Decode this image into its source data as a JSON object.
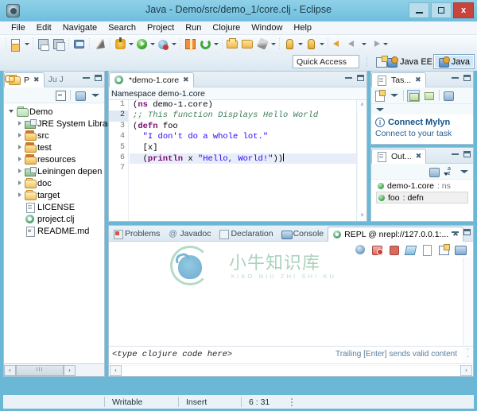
{
  "window": {
    "title": "Java - Demo/src/demo_1/core.clj - Eclipse",
    "app_icon": "eclipse-icon",
    "minimize": "–",
    "maximize": "□",
    "close": "x"
  },
  "menubar": {
    "items": [
      "File",
      "Edit",
      "Navigate",
      "Search",
      "Project",
      "Run",
      "Clojure",
      "Window",
      "Help"
    ]
  },
  "toolbar": {
    "icons": [
      "new-wizard-icon",
      "save-icon",
      "save-all-icon",
      "print-icon",
      "toggle-mark-occurrences-icon",
      "debug-icon",
      "run-icon",
      "profile-icon",
      "new-package-icon",
      "refresh-icon",
      "open-type-icon",
      "open-resource-icon",
      "build-icon",
      "next-annotation-icon",
      "previous-annotation-icon",
      "back-icon",
      "forward-icon"
    ],
    "quick_access": {
      "placeholder": "Quick Access",
      "value": "Quick Access"
    },
    "open_perspective_icon": "open-perspective-icon",
    "perspectives": [
      {
        "label": "Java EE",
        "active": false
      },
      {
        "label": "Java",
        "active": true
      }
    ]
  },
  "package_explorer": {
    "tabs": [
      {
        "label": "P",
        "active": true,
        "icon": "package-explorer-icon",
        "closable": true
      },
      {
        "label": "Ju J",
        "active": false,
        "icon": "junit-icon",
        "closable": false
      }
    ],
    "view_buttons": [
      "minimize-icon",
      "maximize-icon"
    ],
    "tools": [
      "collapse-all-icon",
      "link-with-editor-icon",
      "view-menu-icon",
      "view-dropdown-icon"
    ],
    "tree": [
      {
        "label": "Demo",
        "icon": "project-icon",
        "indent": 0,
        "arrow": "open"
      },
      {
        "label": "JRE System Librar",
        "icon": "library-icon",
        "indent": 1,
        "arrow": "closed"
      },
      {
        "label": "src",
        "icon": "source-folder-icon",
        "indent": 1,
        "arrow": "closed"
      },
      {
        "label": "test",
        "icon": "source-folder-icon",
        "indent": 1,
        "arrow": "closed"
      },
      {
        "label": "resources",
        "icon": "source-folder-icon",
        "indent": 1,
        "arrow": "closed"
      },
      {
        "label": "Leiningen depen",
        "icon": "library-icon",
        "indent": 1,
        "arrow": "closed"
      },
      {
        "label": "doc",
        "icon": "folder-icon",
        "indent": 1,
        "arrow": "closed"
      },
      {
        "label": "target",
        "icon": "folder-icon",
        "indent": 1,
        "arrow": "closed"
      },
      {
        "label": "LICENSE",
        "icon": "file-icon",
        "indent": 1,
        "arrow": "none"
      },
      {
        "label": "project.clj",
        "icon": "clojure-file-icon",
        "indent": 1,
        "arrow": "none"
      },
      {
        "label": "README.md",
        "icon": "markdown-file-icon",
        "indent": 1,
        "arrow": "none"
      }
    ],
    "hscroll": {
      "left_arrow": "‹",
      "right_arrow": "›",
      "thumb": "III"
    }
  },
  "editor": {
    "tab": {
      "label": "*demo-1.core",
      "icon": "clojure-file-icon",
      "close": "✖"
    },
    "breadcrumb": "Namespace demo-1.core",
    "view_buttons": [
      "minimize-icon",
      "maximize-icon"
    ],
    "lines": [
      {
        "num": "1",
        "selected": false,
        "highlight": false,
        "tokens": [
          {
            "t": "(",
            "c": "pn"
          },
          {
            "t": "ns",
            "c": "kw"
          },
          {
            "t": " demo-1.core)",
            "c": "pn"
          }
        ]
      },
      {
        "num": "2",
        "selected": true,
        "highlight": false,
        "tokens": [
          {
            "t": ";; This function Displays Hello World",
            "c": "cm"
          }
        ]
      },
      {
        "num": "3",
        "selected": false,
        "highlight": false,
        "tokens": [
          {
            "t": "(",
            "c": "pn"
          },
          {
            "t": "defn",
            "c": "kw"
          },
          {
            "t": " foo",
            "c": "pn"
          }
        ]
      },
      {
        "num": "4",
        "selected": false,
        "highlight": false,
        "tokens": [
          {
            "t": "  ",
            "c": "pn"
          },
          {
            "t": "\"I don't do a whole lot.\"",
            "c": "st"
          }
        ]
      },
      {
        "num": "5",
        "selected": false,
        "highlight": false,
        "tokens": [
          {
            "t": "  [x]",
            "c": "pn"
          }
        ]
      },
      {
        "num": "6",
        "selected": false,
        "highlight": true,
        "tokens": [
          {
            "t": "  (",
            "c": "pn"
          },
          {
            "t": "println",
            "c": "kw"
          },
          {
            "t": " x ",
            "c": "pn"
          },
          {
            "t": "\"Hello, World!\"",
            "c": "st"
          },
          {
            "t": "))",
            "c": "pn"
          }
        ]
      },
      {
        "num": "7",
        "selected": false,
        "highlight": false,
        "tokens": [
          {
            "t": "",
            "c": "pn"
          }
        ]
      }
    ],
    "scrollbar": {
      "up": "˄",
      "down": "˅"
    }
  },
  "task_list": {
    "tab": {
      "label": "Tas...",
      "icon": "task-list-icon",
      "close": "✖"
    },
    "view_buttons": [
      "minimize-icon",
      "maximize-icon"
    ],
    "tools": [
      "new-task-icon",
      "categorized-presentation-icon",
      "scheduled-presentation-icon",
      "focus-on-workweek-icon",
      "view-menu-icon"
    ],
    "mylyn": {
      "title": "Connect Mylyn",
      "subtitle": "Connect to your task"
    }
  },
  "outline": {
    "tab": {
      "label": "Out...",
      "icon": "outline-icon",
      "close": "✖"
    },
    "view_buttons": [
      "minimize-icon",
      "maximize-icon"
    ],
    "tools": [
      "view-menu-icon",
      "sort-icon",
      "view-dropdown-icon"
    ],
    "items": [
      {
        "name": "demo-1.core",
        "kind": "ns",
        "selected": false
      },
      {
        "name": "foo",
        "kind": "defn",
        "selected": true
      }
    ]
  },
  "bottom_panel": {
    "tabs": [
      {
        "label": "Problems",
        "icon": "problems-icon",
        "active": false
      },
      {
        "label": "Javadoc",
        "icon": "javadoc-icon",
        "active": false
      },
      {
        "label": "Declaration",
        "icon": "declaration-icon",
        "active": false
      },
      {
        "label": "Console",
        "icon": "console-icon",
        "active": false
      },
      {
        "label": "REPL @ nrepl://127.0.0.1:...",
        "icon": "repl-icon",
        "active": true,
        "close": "✖"
      }
    ],
    "view_buttons": [
      "minimize-icon",
      "maximize-icon"
    ],
    "tools": [
      "reconnect-icon",
      "interrupt-evaluation-icon",
      "terminate-icon",
      "clear-icon",
      "clear-output-icon",
      "new-repl-icon",
      "display-console-icon"
    ],
    "output": "",
    "input": {
      "value": "<type clojure code here>",
      "hint": "Trailing [Enter] sends valid content"
    },
    "hscroll": {
      "left_arrow": "‹",
      "right_arrow": "›"
    }
  },
  "statusbar": {
    "writable": "Writable",
    "insert": "Insert",
    "position": "6 : 31"
  },
  "watermark": {
    "text": "小牛知识库",
    "subtext": "XIAO NIU ZHI SHI KU"
  },
  "colors": {
    "title_bg": "#6fbedd",
    "accent": "#16538a",
    "keyword": "#7a0874",
    "string": "#2a00ff",
    "comment": "#3f7f5f"
  }
}
